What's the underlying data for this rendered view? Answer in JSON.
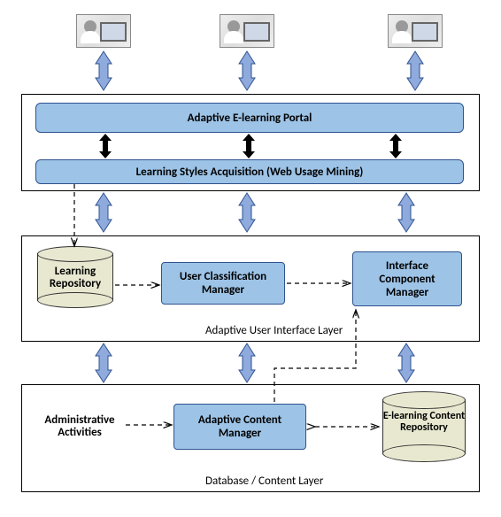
{
  "layers": {
    "top": {
      "portal": "Adaptive E-learning Portal",
      "acquisition": "Learning Styles Acquisition (Web Usage Mining)"
    },
    "middle": {
      "repository": "Learning Repository",
      "classifier": "User Classification Manager",
      "interface": "Interface Component Manager",
      "caption": "Adaptive User Interface Layer"
    },
    "bottom": {
      "admin": "Administrative Activities",
      "content_mgr": "Adaptive Content Manager",
      "elearn_repo": "E-learning Content Repository",
      "caption": "Database / Content Layer"
    }
  },
  "colors": {
    "box_fill": "#9dc3e6",
    "box_stroke": "#2e528f",
    "arrow_blue": "#8faadc",
    "arrow_black": "#000000",
    "cylinder": "#e8e8d0"
  }
}
